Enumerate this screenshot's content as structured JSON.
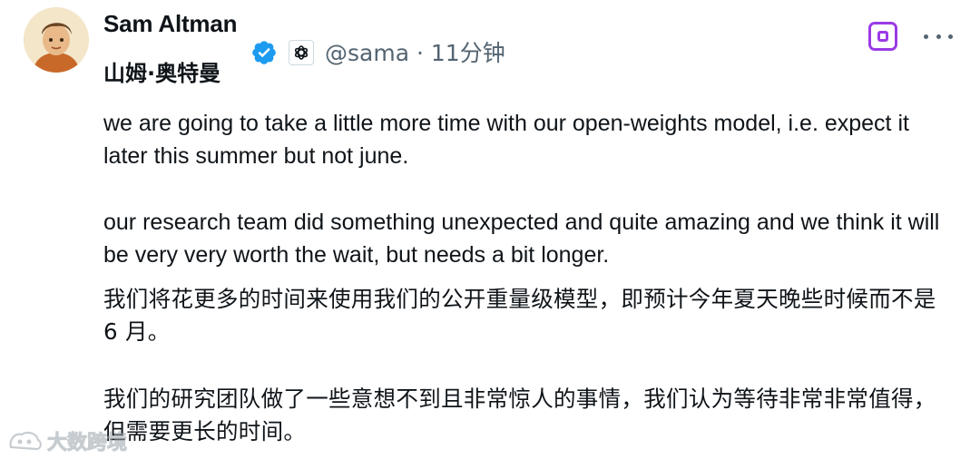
{
  "author": {
    "name": "Sam Altman",
    "cn_name": "山姆·奥特曼",
    "handle": "@sama",
    "separator": "·",
    "time": "11分钟"
  },
  "icons": {
    "verified": "verified-badge-icon",
    "affiliation": "openai-logo-icon",
    "grok": "grok-icon",
    "more": "more-options-icon",
    "brand_color": "#1d9bf0",
    "grok_color": "#9b3be6"
  },
  "tweet": {
    "en_para1": "we are going to take a little more time with our open-weights model, i.e. expect it later this summer but not june.",
    "en_para2": "our research team did something unexpected and quite amazing and we think it will be very very worth the wait, but needs a bit longer.",
    "zh_para1": "我们将花更多的时间来使用我们的公开重量级模型，即预计今年夏天晚些时候而不是 6 月。",
    "zh_para2": "我们的研究团队做了一些意想不到且非常惊人的事情，我们认为等待非常非常值得，但需要更长的时间。"
  },
  "watermark": {
    "text": "大数跨境"
  }
}
